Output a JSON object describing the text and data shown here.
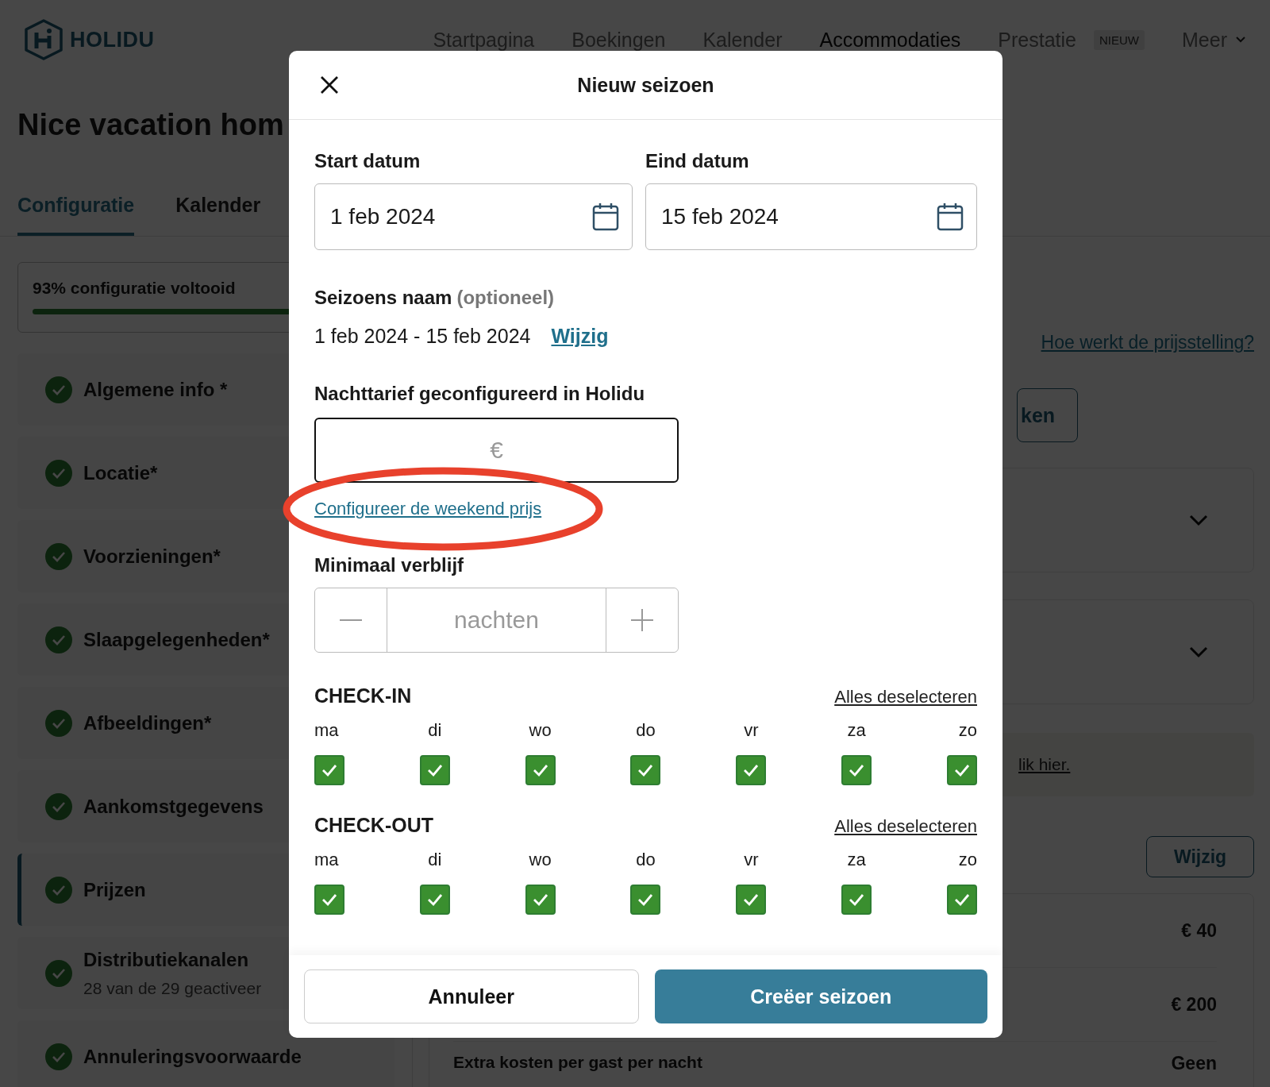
{
  "header": {
    "logo": "HOLIDU",
    "nav": [
      {
        "label": "Startpagina",
        "selected": false
      },
      {
        "label": "Boekingen",
        "selected": false
      },
      {
        "label": "Kalender",
        "selected": false
      },
      {
        "label": "Accommodaties",
        "selected": true
      },
      {
        "label": "Prestatie",
        "selected": false,
        "badge": "NIEUW"
      },
      {
        "label": "Meer",
        "selected": false,
        "dropdown": true
      }
    ]
  },
  "page_title": "Nice vacation hom",
  "tabs": [
    {
      "label": "Configuratie",
      "selected": true
    },
    {
      "label": "Kalender",
      "selected": false
    }
  ],
  "progress": {
    "label": "93% configuratie voltooid",
    "level": 0.93
  },
  "sidebar": {
    "items": [
      {
        "label": "Algemene info *",
        "done": true,
        "selected": false
      },
      {
        "label": "Locatie*",
        "done": true,
        "selected": false
      },
      {
        "label": "Voorzieningen*",
        "done": true,
        "selected": false
      },
      {
        "label": "Slaapgelegenheden*",
        "done": true,
        "selected": false
      },
      {
        "label": "Afbeeldingen*",
        "done": true,
        "selected": false
      },
      {
        "label": "Aankomstgegevens",
        "done": true,
        "selected": false
      },
      {
        "label": "Prijzen",
        "done": true,
        "selected": true
      },
      {
        "label": "Distributiekanalen",
        "subtitle": "28 van de 29 geactiveer",
        "done": true,
        "selected": false
      },
      {
        "label": "Annuleringsvoorwaarde",
        "done": true,
        "selected": false
      }
    ]
  },
  "content": {
    "help_link": "Hoe werkt de prijsstelling?",
    "button_1": "ken",
    "sections": [
      {
        "expanded": false
      },
      {
        "expanded": false
      }
    ],
    "banner_link": "lik hier.",
    "edit_button": "Wijzig",
    "prices": [
      "€ 40",
      "€ 200"
    ],
    "extra_row": {
      "label": "Extra kosten per gast per nacht",
      "value": "Geen"
    }
  },
  "modal": {
    "title": "Nieuw seizoen",
    "start": {
      "label": "Start datum",
      "value": "1 feb 2024"
    },
    "end": {
      "label": "Eind datum",
      "value": "15 feb 2024"
    },
    "season_name": {
      "label": "Seizoens naam",
      "optional": "(optioneel)",
      "value": "1 feb 2024 - 15 feb 2024",
      "edit_link": "Wijzig"
    },
    "night_rate": {
      "label": "Nachttarief geconfigureerd in Holidu",
      "placeholder": "€",
      "weekend_link": "Configureer de weekend prijs"
    },
    "annotations": [
      {
        "kind": "ellipse"
      }
    ],
    "min_stay": {
      "label": "Minimaal verblijf",
      "placeholder": "nachten"
    },
    "check_in": {
      "title": "CHECK-IN",
      "deselect_all": "Alles deselecteren",
      "days": [
        {
          "label": "ma",
          "checked": true
        },
        {
          "label": "di",
          "checked": true
        },
        {
          "label": "wo",
          "checked": true
        },
        {
          "label": "do",
          "checked": true
        },
        {
          "label": "vr",
          "checked": true
        },
        {
          "label": "za",
          "checked": true
        },
        {
          "label": "zo",
          "checked": true
        }
      ]
    },
    "check_out": {
      "title": "CHECK-OUT",
      "deselect_all": "Alles deselecteren",
      "days": [
        {
          "label": "ma",
          "checked": true
        },
        {
          "label": "di",
          "checked": true
        },
        {
          "label": "wo",
          "checked": true
        },
        {
          "label": "do",
          "checked": true
        },
        {
          "label": "vr",
          "checked": true
        },
        {
          "label": "za",
          "checked": true
        },
        {
          "label": "zo",
          "checked": true
        }
      ]
    },
    "cancel_button": "Annuleer",
    "create_button": "Creëer seizoen"
  }
}
